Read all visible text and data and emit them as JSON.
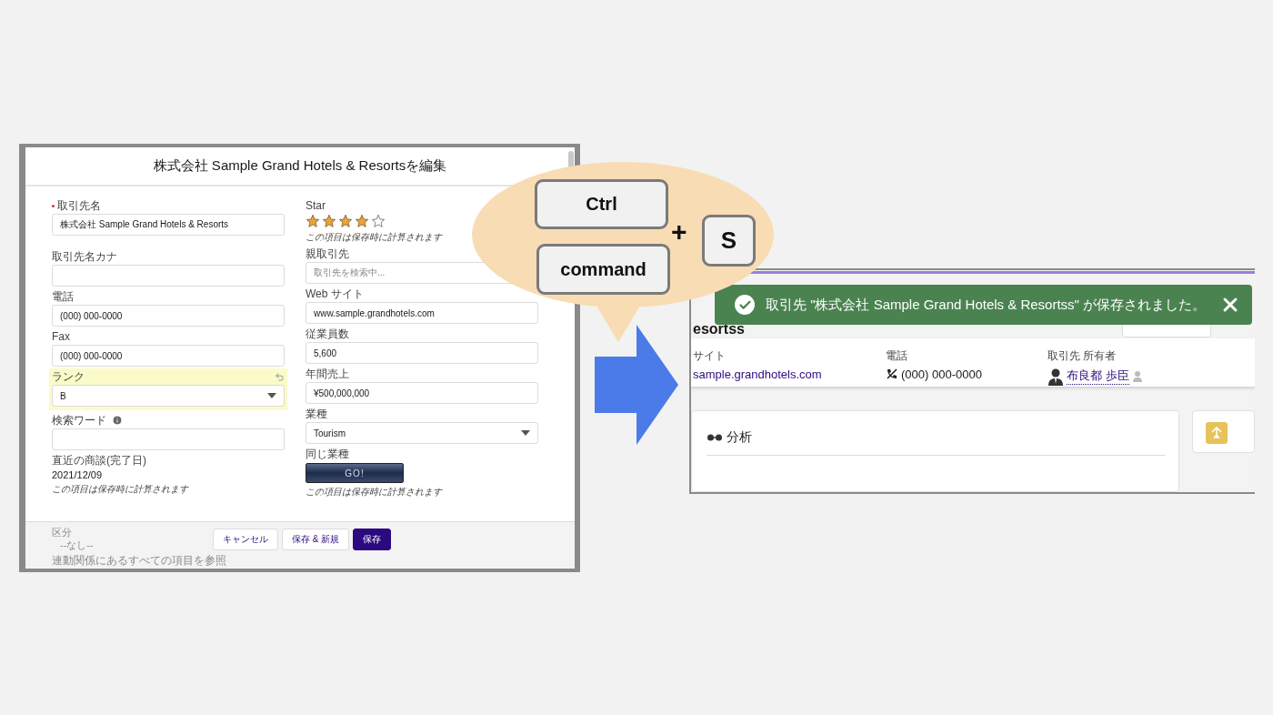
{
  "edit_dialog": {
    "title": "株式会社 Sample Grand Hotels & Resortsを編集",
    "left_fields": [
      {
        "kind": "input",
        "label": "取引先名",
        "required": true,
        "value": "株式会社 Sample Grand Hotels & Resorts"
      },
      {
        "kind": "input",
        "label": "取引先名カナ"
      },
      {
        "kind": "input",
        "label": "電話",
        "value": "(000) 000-0000"
      },
      {
        "kind": "input",
        "label": "Fax",
        "value": "(000) 000-0000"
      },
      {
        "kind": "select",
        "label": "ランク",
        "value": "B",
        "changed": true
      },
      {
        "kind": "input",
        "label": "検索ワード",
        "info": true
      },
      {
        "kind": "readonly",
        "label": "直近の商談(完了日)",
        "value": "2021/12/09",
        "note": "この項目は保存時に計算されます"
      }
    ],
    "right_fields": [
      {
        "kind": "stars",
        "label": "Star",
        "stars": 4,
        "note": "この項目は保存時に計算されます"
      },
      {
        "kind": "input",
        "label": "親取引先",
        "placeholder": "取引先を検索中..."
      },
      {
        "kind": "input",
        "label": "Web サイト",
        "value": "www.sample.grandhotels.com"
      },
      {
        "kind": "input",
        "label": "従業員数",
        "value": "5,600"
      },
      {
        "kind": "input",
        "label": "年間売上",
        "value": "¥500,000,000"
      },
      {
        "kind": "select",
        "label": "業種",
        "value": "Tourism"
      },
      {
        "kind": "button",
        "label": "同じ業種",
        "button": "GO!",
        "note": "この項目は保存時に計算されます"
      }
    ],
    "behind_footer": {
      "label": "区分",
      "value": "--なし--",
      "link": "連動関係にあるすべての項目を参照"
    },
    "buttons": [
      {
        "label": "キャンセル",
        "kind": "neutral"
      },
      {
        "label": "保存 & 新規",
        "kind": "neutral"
      },
      {
        "label": "保存",
        "kind": "brand"
      }
    ]
  },
  "shortcut": {
    "keys": [
      "Ctrl",
      "command"
    ],
    "plus": "+",
    "key": "S"
  },
  "record_page": {
    "toast": {
      "message": "取引先 \"株式会社 Sample Grand Hotels & Resortss\" が保存されました。"
    },
    "title": "esortss",
    "highlights": [
      {
        "kind": "link",
        "label": "サイト",
        "value": "sample.grandhotels.com"
      },
      {
        "kind": "phone",
        "label": "電話",
        "value": "(000) 000-0000"
      },
      {
        "kind": "owner",
        "label": "取引先 所有者",
        "value": "布良都 歩臣"
      }
    ],
    "card_title": "分析"
  }
}
